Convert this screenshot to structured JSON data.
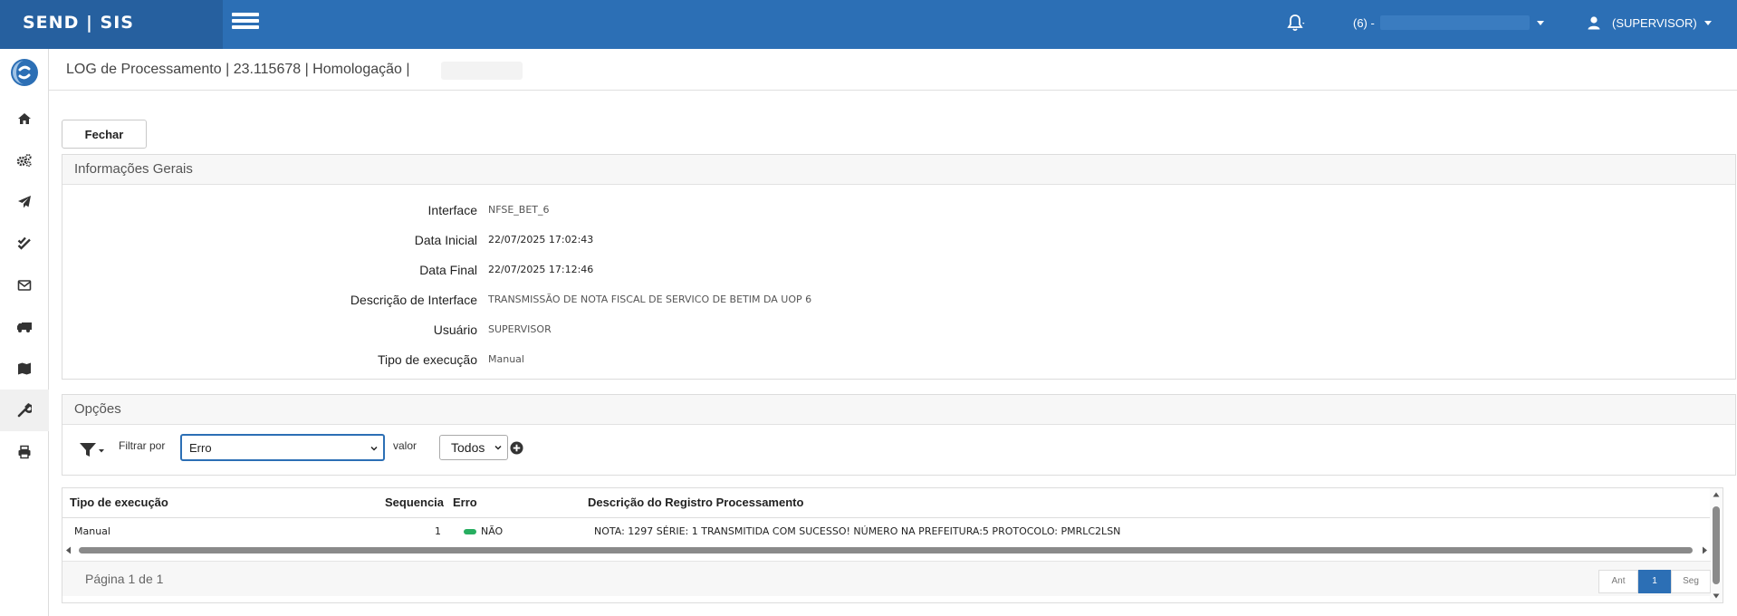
{
  "app": {
    "brand": "SEND | SIS"
  },
  "header": {
    "org_label": "(6) -",
    "user_label": "(SUPERVISOR)"
  },
  "page": {
    "title": "LOG de Processamento | 23.115678 | Homologação |"
  },
  "actions": {
    "close_label": "Fechar"
  },
  "general_info": {
    "title": "Informações Gerais",
    "fields": [
      {
        "label": "Interface",
        "value": "NFSE_BET_6"
      },
      {
        "label": "Data Inicial",
        "value": "22/07/2025 17:02:43"
      },
      {
        "label": "Data Final",
        "value": "22/07/2025 17:12:46"
      },
      {
        "label": "Descrição de Interface",
        "value": "TRANSMISSÃO DE NOTA FISCAL DE SERVICO DE BETIM DA UOP 6"
      },
      {
        "label": "Usuário",
        "value": "SUPERVISOR"
      },
      {
        "label": "Tipo de execução",
        "value": "Manual"
      }
    ]
  },
  "options": {
    "title": "Opções",
    "filter_label": "Filtrar por",
    "filter_value": "Erro",
    "valor_label": "valor",
    "valor_value": "Todos"
  },
  "table": {
    "columns": [
      "Tipo de execução",
      "Sequencia",
      "Erro",
      "Descrição do Registro Processamento"
    ],
    "rows": [
      {
        "tipo": "Manual",
        "sequencia": "1",
        "erro": "NÃO",
        "descricao": "NOTA: 1297 SÉRIE: 1 TRANSMITIDA COM SUCESSO! NÚMERO NA PREFEITURA:5 PROTOCOLO: PMRLC2LSN"
      }
    ],
    "status_color": "#27ae60"
  },
  "pagination": {
    "text": "Página 1 de 1",
    "prev": "Ant",
    "current": "1",
    "next": "Seg"
  },
  "colors": {
    "header": "#2c6fb5",
    "brand_bg": "#26609f"
  }
}
